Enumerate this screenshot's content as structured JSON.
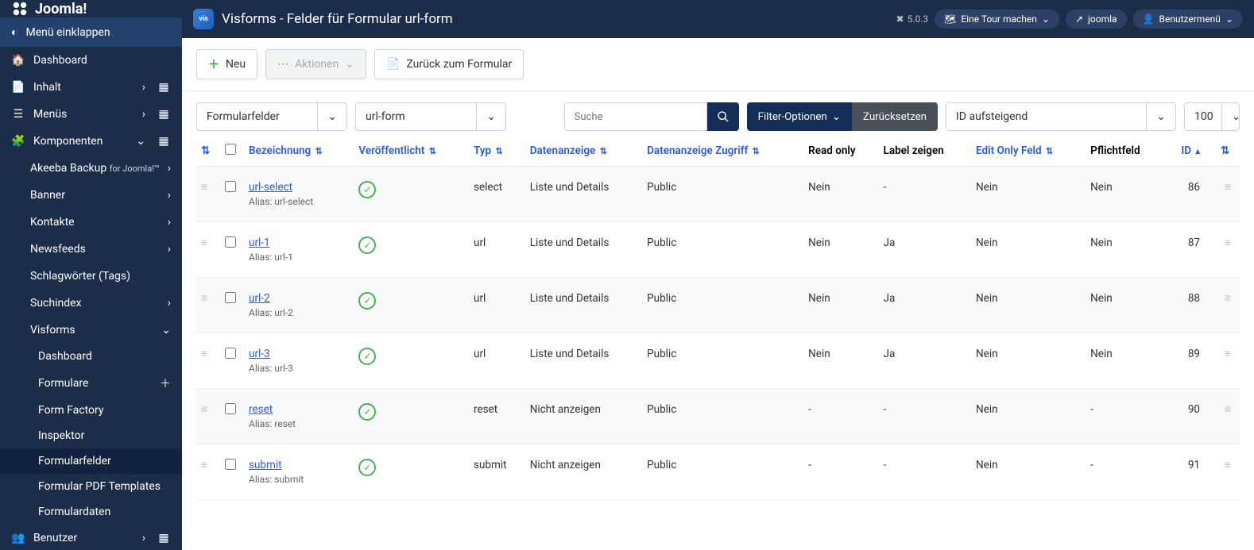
{
  "brand": "Joomla!",
  "sidebar": {
    "collapse": "Menü einklappen",
    "dashboard": "Dashboard",
    "inhalt": "Inhalt",
    "menus": "Menüs",
    "komponenten": "Komponenten",
    "akeeba": "Akeeba Backup",
    "akeeba_suffix": "for Joomla!™",
    "banner": "Banner",
    "kontakte": "Kontakte",
    "newsfeeds": "Newsfeeds",
    "tags": "Schlagwörter (Tags)",
    "suchindex": "Suchindex",
    "visforms": "Visforms",
    "vf_dashboard": "Dashboard",
    "vf_formulare": "Formulare",
    "vf_formfactory": "Form Factory",
    "vf_inspektor": "Inspektor",
    "vf_formularfelder": "Formularfelder",
    "vf_pdf": "Formular PDF Templates",
    "vf_daten": "Formulardaten",
    "benutzer": "Benutzer"
  },
  "header": {
    "title": "Visforms - Felder für Formular url-form",
    "version": "5.0.3",
    "tour": "Eine Tour machen",
    "site": "joomla",
    "usermenu": "Benutzermenü"
  },
  "toolbar": {
    "neu": "Neu",
    "aktionen": "Aktionen",
    "zurueck": "Zurück zum Formular"
  },
  "filters": {
    "left1": "Formularfelder",
    "left2": "url-form",
    "search_ph": "Suche",
    "filter_opts": "Filter-Optionen",
    "reset": "Zurücksetzen",
    "sort": "ID aufsteigend",
    "limit": "100"
  },
  "columns": {
    "bezeichnung": "Bezeichnung",
    "published": "Veröffentlicht",
    "typ": "Typ",
    "datenanzeige": "Datenanzeige",
    "zugriff": "Datenanzeige Zugriff",
    "readonly": "Read only",
    "labelzeigen": "Label zeigen",
    "editonly": "Edit Only Feld",
    "pflicht": "Pflichtfeld",
    "id": "ID"
  },
  "alias_prefix": "Alias: ",
  "rows": [
    {
      "name": "url-select",
      "alias": "url-select",
      "typ": "select",
      "datenanzeige": "Liste und Details",
      "zugriff": "Public",
      "readonly": "Nein",
      "label": "-",
      "editonly": "Nein",
      "pflicht": "Nein",
      "id": "86"
    },
    {
      "name": "url-1",
      "alias": "url-1",
      "typ": "url",
      "datenanzeige": "Liste und Details",
      "zugriff": "Public",
      "readonly": "Nein",
      "label": "Ja",
      "editonly": "Nein",
      "pflicht": "Nein",
      "id": "87"
    },
    {
      "name": "url-2",
      "alias": "url-2",
      "typ": "url",
      "datenanzeige": "Liste und Details",
      "zugriff": "Public",
      "readonly": "Nein",
      "label": "Ja",
      "editonly": "Nein",
      "pflicht": "Nein",
      "id": "88"
    },
    {
      "name": "url-3",
      "alias": "url-3",
      "typ": "url",
      "datenanzeige": "Liste und Details",
      "zugriff": "Public",
      "readonly": "Nein",
      "label": "Ja",
      "editonly": "Nein",
      "pflicht": "Nein",
      "id": "89"
    },
    {
      "name": "reset",
      "alias": "reset",
      "typ": "reset",
      "datenanzeige": "Nicht anzeigen",
      "zugriff": "Public",
      "readonly": "-",
      "label": "-",
      "editonly": "Nein",
      "pflicht": "-",
      "id": "90"
    },
    {
      "name": "submit",
      "alias": "submit",
      "typ": "submit",
      "datenanzeige": "Nicht anzeigen",
      "zugriff": "Public",
      "readonly": "-",
      "label": "-",
      "editonly": "Nein",
      "pflicht": "-",
      "id": "91"
    }
  ]
}
